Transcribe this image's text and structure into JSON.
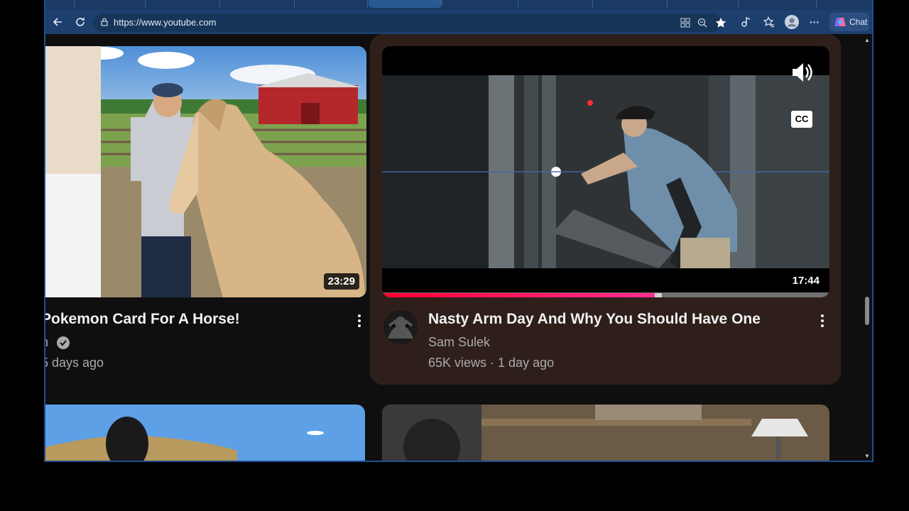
{
  "browser": {
    "url": "https://www.youtube.com",
    "chat_label": "Chat",
    "accent": "#1e4f8f"
  },
  "videos": [
    {
      "title": "Pokemon Card For A Horse!",
      "channel": "n",
      "verified": true,
      "age": "5 days ago",
      "duration": "23:29"
    },
    {
      "title": "Nasty Arm Day And Why You Should Have One",
      "channel": "Sam Sulek",
      "views_age": "65K views · 1 day ago",
      "duration": "17:44",
      "progress": 0.61,
      "cc": "CC"
    }
  ],
  "colors": {
    "progress": "#ff0033",
    "hover_card": "#2e1f1b",
    "background": "#0f0f0f"
  },
  "icons": [
    "back-icon",
    "refresh-icon",
    "lock-icon",
    "apps-icon",
    "zoom-icon",
    "star-icon",
    "media-icon",
    "favorites-icon",
    "profile-icon",
    "more-icon",
    "copilot-icon",
    "volume-icon",
    "cc-icon",
    "verified-icon",
    "kebab-icon"
  ]
}
